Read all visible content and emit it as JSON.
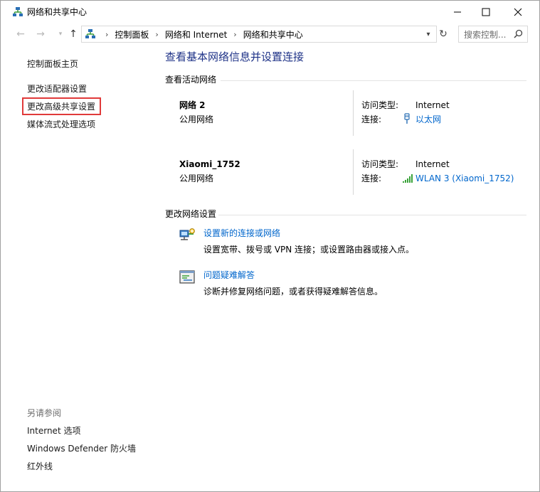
{
  "window": {
    "title": "网络和共享中心",
    "icon": "network-center-icon",
    "controls": {
      "minimize": "minimize-icon",
      "maximize": "maximize-icon",
      "close": "close-icon"
    }
  },
  "address": {
    "breadcrumbs": [
      "控制面板",
      "网络和 Internet",
      "网络和共享中心"
    ],
    "search_placeholder": "搜索控制..."
  },
  "sidebar": {
    "items": [
      "控制面板主页",
      "更改适配器设置",
      "更改高级共享设置",
      "媒体流式处理选项"
    ],
    "see_also_label": "另请参阅",
    "see_also": [
      "Internet 选项",
      "Windows Defender 防火墙",
      "红外线"
    ]
  },
  "main": {
    "heading": "查看基本网络信息并设置连接",
    "active_section": "查看活动网络",
    "networks": [
      {
        "name": "网络 2",
        "category": "公用网络",
        "access_label": "访问类型:",
        "access_value": "Internet",
        "conn_label": "连接:",
        "conn_value": "以太网",
        "conn_icon": "ethernet-icon"
      },
      {
        "name": "Xiaomi_1752",
        "category": "公用网络",
        "access_label": "访问类型:",
        "access_value": "Internet",
        "conn_label": "连接:",
        "conn_value": "WLAN 3 (Xiaomi_1752)",
        "conn_icon": "wifi-signal-icon"
      }
    ],
    "change_section": "更改网络设置",
    "tasks": [
      {
        "title": "设置新的连接或网络",
        "description": "设置宽带、拨号或 VPN 连接；或设置路由器或接入点。",
        "icon": "new-connection-icon"
      },
      {
        "title": "问题疑难解答",
        "description": "诊断并修复网络问题，或者获得疑难解答信息。",
        "icon": "troubleshoot-icon"
      }
    ]
  },
  "colors": {
    "link": "#0066cc",
    "heading": "#1e3287",
    "highlight": "#e03a3a"
  }
}
